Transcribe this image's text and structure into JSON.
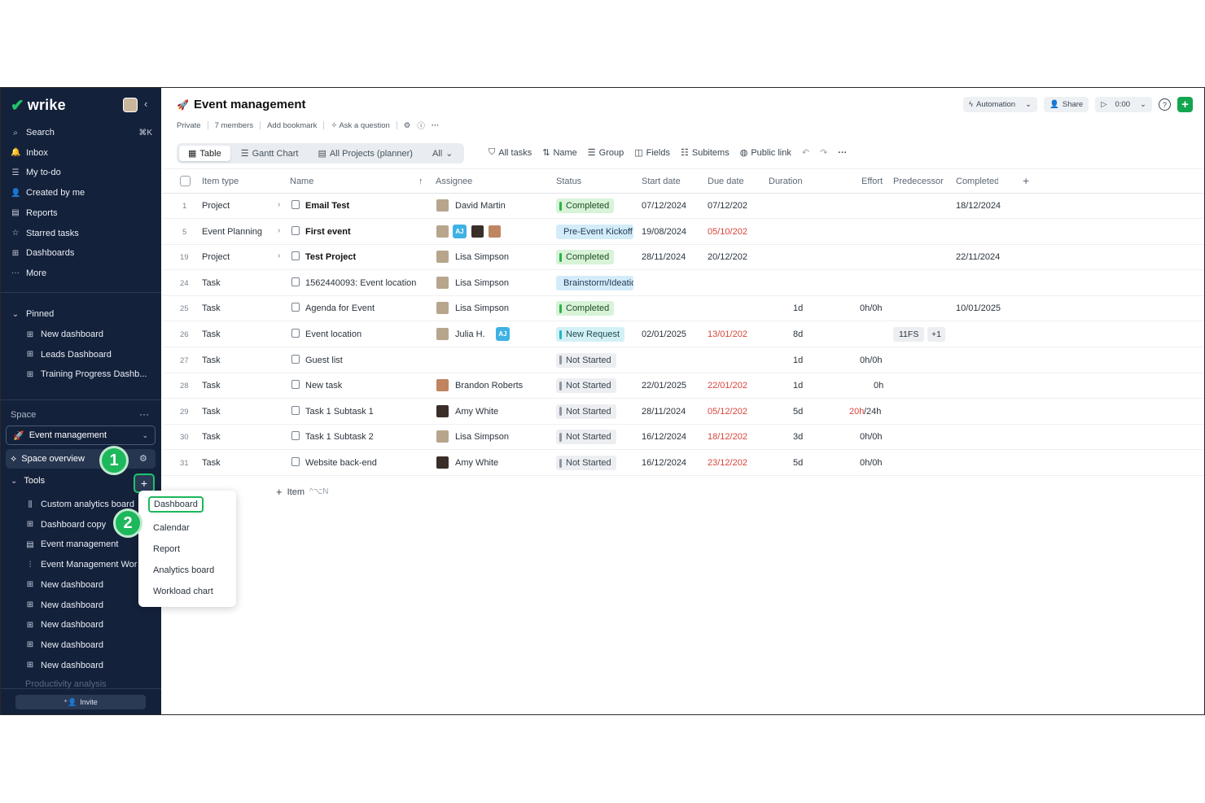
{
  "brand": "wrike",
  "nav": [
    {
      "icon": "search-icon",
      "glyph": "⌕",
      "label": "Search",
      "kbd": "⌘K"
    },
    {
      "icon": "bell-icon",
      "glyph": "🔔",
      "label": "Inbox"
    },
    {
      "icon": "todo-icon",
      "glyph": "☰",
      "label": "My to-do"
    },
    {
      "icon": "user-icon",
      "glyph": "👤",
      "label": "Created by me"
    },
    {
      "icon": "report-icon",
      "glyph": "▤",
      "label": "Reports"
    },
    {
      "icon": "star-icon",
      "glyph": "☆",
      "label": "Starred tasks"
    },
    {
      "icon": "dashboard-icon",
      "glyph": "⊞",
      "label": "Dashboards"
    },
    {
      "icon": "more-icon",
      "glyph": "···",
      "label": "More"
    }
  ],
  "pinned": {
    "label": "Pinned",
    "items": [
      "New dashboard",
      "Leads Dashboard",
      "Training Progress Dashb..."
    ]
  },
  "space": {
    "label": "Space",
    "selected": "Event management",
    "overview": "Space overview"
  },
  "tools": {
    "label": "Tools",
    "items": [
      {
        "icon": "analytics-icon",
        "glyph": "⫼",
        "label": "Custom analytics board"
      },
      {
        "icon": "dashboard-icon",
        "glyph": "⊞",
        "label": "Dashboard copy"
      },
      {
        "icon": "project-icon",
        "glyph": "▤",
        "label": "Event management"
      },
      {
        "icon": "workload-icon",
        "glyph": "⫶",
        "label": "Event Management Wor"
      },
      {
        "icon": "dashboard-icon",
        "glyph": "⊞",
        "label": "New dashboard"
      },
      {
        "icon": "dashboard-icon",
        "glyph": "⊞",
        "label": "New dashboard"
      },
      {
        "icon": "dashboard-icon",
        "glyph": "⊞",
        "label": "New dashboard"
      },
      {
        "icon": "dashboard-icon",
        "glyph": "⊞",
        "label": "New dashboard"
      },
      {
        "icon": "dashboard-icon",
        "glyph": "⊞",
        "label": "New dashboard"
      }
    ],
    "faded": "Productivity analysis"
  },
  "invite": "Invite",
  "steps": [
    "1",
    "2"
  ],
  "header": {
    "title": "Event management",
    "meta": [
      "Private",
      "7 members",
      "Add bookmark",
      "Ask a question"
    ],
    "automation": "Automation",
    "share": "Share",
    "timer": "0:00"
  },
  "views": {
    "tabs": [
      "Table",
      "Gantt Chart",
      "All Projects (planner)"
    ],
    "filter": "All"
  },
  "toolbar": [
    "All tasks",
    "Name",
    "Group",
    "Fields",
    "Subitems",
    "Public link"
  ],
  "columns": [
    "Item type",
    "Name",
    "Assignee",
    "Status",
    "Start date",
    "Due date",
    "Duration",
    "Effort",
    "Predecessor",
    "Completed d"
  ],
  "rows": [
    {
      "id": "1",
      "type": "Project",
      "name": "Email Test",
      "bold": true,
      "expand": true,
      "assignee": "David Martin",
      "status": "Completed",
      "st": "green",
      "start": "07/12/2024",
      "due": "07/12/202",
      "dueRed": false,
      "duration": "",
      "effort": "",
      "completed": "18/12/2024"
    },
    {
      "id": "5",
      "type": "Event Planning",
      "name": "First event",
      "bold": true,
      "expand": true,
      "assignee": "",
      "multi": true,
      "status": "Pre-Event Kickoff",
      "st": "blue",
      "start": "19/08/2024",
      "due": "05/10/202",
      "dueRed": true,
      "duration": "",
      "effort": "",
      "completed": ""
    },
    {
      "id": "19",
      "type": "Project",
      "name": "Test Project",
      "bold": true,
      "expand": true,
      "assignee": "Lisa Simpson",
      "status": "Completed",
      "st": "green",
      "start": "28/11/2024",
      "due": "20/12/202",
      "dueRed": false,
      "duration": "",
      "effort": "",
      "completed": "22/11/2024"
    },
    {
      "id": "24",
      "type": "Task",
      "name": "1562440093: Event location",
      "assignee": "Lisa Simpson",
      "status": "Brainstorm/Ideation",
      "st": "blue",
      "start": "",
      "due": "",
      "duration": "",
      "effort": "",
      "completed": ""
    },
    {
      "id": "25",
      "type": "Task",
      "name": "Agenda for Event",
      "assignee": "Lisa Simpson",
      "status": "Completed",
      "st": "green",
      "start": "",
      "due": "",
      "duration": "1d",
      "effort": "0h/0h",
      "completed": "10/01/2025"
    },
    {
      "id": "26",
      "type": "Task",
      "name": "Event location",
      "assignee": "Julia H.",
      "aj": "AJ",
      "status": "New Request",
      "st": "cyan",
      "start": "02/01/2025",
      "due": "13/01/202",
      "dueRed": true,
      "duration": "8d",
      "effort": "",
      "pred": "11FS",
      "predMore": "+1",
      "completed": ""
    },
    {
      "id": "27",
      "type": "Task",
      "name": "Guest list",
      "assignee": "",
      "status": "Not Started",
      "st": "gray",
      "start": "",
      "due": "",
      "duration": "1d",
      "effort": "0h/0h",
      "completed": ""
    },
    {
      "id": "28",
      "type": "Task",
      "name": "New task",
      "assignee": "Brandon Roberts",
      "status": "Not Started",
      "st": "gray",
      "start": "22/01/2025",
      "due": "22/01/202",
      "dueRed": true,
      "duration": "1d",
      "effort": "0h",
      "completed": ""
    },
    {
      "id": "29",
      "type": "Task",
      "name": "Task 1 Subtask 1",
      "assignee": "Amy White",
      "status": "Not Started",
      "st": "gray",
      "start": "28/11/2024",
      "due": "05/12/202",
      "dueRed": true,
      "duration": "5d",
      "effortRed": "20h",
      "effort": "/24h",
      "completed": ""
    },
    {
      "id": "30",
      "type": "Task",
      "name": "Task 1 Subtask 2",
      "assignee": "Lisa Simpson",
      "status": "Not Started",
      "st": "gray",
      "start": "16/12/2024",
      "due": "18/12/202",
      "dueRed": true,
      "duration": "3d",
      "effort": "0h/0h",
      "completed": ""
    },
    {
      "id": "31",
      "type": "Task",
      "name": "Website back-end",
      "assignee": "Amy White",
      "status": "Not Started",
      "st": "gray",
      "start": "16/12/2024",
      "due": "23/12/202",
      "dueRed": true,
      "duration": "5d",
      "effort": "0h/0h",
      "completed": ""
    }
  ],
  "add_item": {
    "label": "Item",
    "hint": "^⌥N"
  },
  "menu": [
    "Dashboard",
    "Calendar",
    "Report",
    "Analytics board",
    "Workload chart"
  ]
}
